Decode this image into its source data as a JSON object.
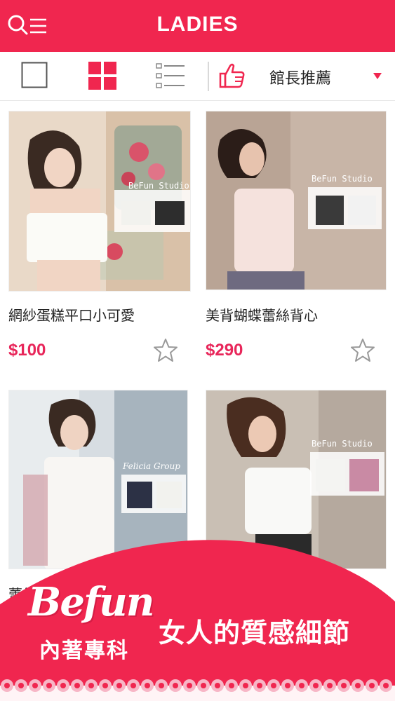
{
  "header": {
    "title": "LADIES",
    "icons": [
      "search-icon",
      "menu-icon"
    ]
  },
  "toolbar": {
    "view_modes": [
      "single-view-icon",
      "grid-view-icon",
      "list-view-icon"
    ],
    "selected_view": "grid-view-icon",
    "sort_icon": "thumbs-up-icon",
    "sort_label": "館長推薦"
  },
  "products": [
    {
      "name": "網紗蛋糕平口小可愛",
      "price": "$100",
      "photo_label": "BeFun Studio"
    },
    {
      "name": "美背蝴蝶蕾絲背心",
      "price": "$290",
      "photo_label": "BeFun Studio"
    },
    {
      "name": "蕾絲",
      "price": "",
      "photo_label": "Felicia Group"
    },
    {
      "name": "",
      "price": "",
      "photo_label": "BeFun Studio"
    }
  ],
  "banner": {
    "brand": "Befun",
    "brand_sub": "內著專科",
    "slogan": "女人的質感細節"
  },
  "colors": {
    "accent": "#f0264f",
    "price": "#e8265a"
  }
}
